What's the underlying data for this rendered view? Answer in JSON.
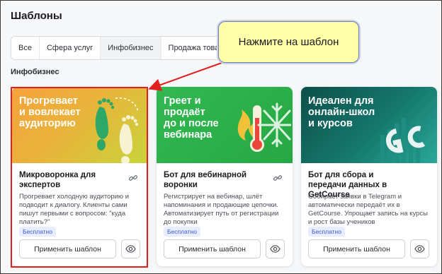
{
  "page": {
    "title": "Шаблоны"
  },
  "tabs": [
    {
      "label": "Все"
    },
    {
      "label": "Сфера услуг"
    },
    {
      "label": "Инфобизнес",
      "active": true
    },
    {
      "label": "Продажа товаров"
    }
  ],
  "section": {
    "title": "Инфобизнес"
  },
  "cards": [
    {
      "banner_text": "Прогревает\nи вовлекает\nаудиторию",
      "banner_colors": [
        "#f6a23c",
        "#c8d43a"
      ],
      "banner_icon": "footprints-icon",
      "title": "Микроворонка для экспертов",
      "description": "Прогревает холодную аудиторию и подводит к диалогу. Клиенты сами пишут первыми с вопросом: \"куда платить?\"",
      "badge": "Бесплатно",
      "button_label": "Применить шаблон"
    },
    {
      "banner_text": "Греет и\nпродаёт\nдо и после\nвебинара",
      "banner_colors": [
        "#2bb24c",
        "#26a843"
      ],
      "banner_icon": "thermometer-fire-snow-icon",
      "title": "Бот для вебинарной воронки",
      "description": "Регистрирует на вебинар, шлёт напоминания и продающие цепочки. Автоматизирует путь от регистрации до покупки",
      "badge": "Бесплатно",
      "button_label": "Применить шаблон"
    },
    {
      "banner_text": "Идеален для\nонлайн-школ\nи курсов",
      "banner_colors": [
        "#0f5e57",
        "#2aa89a"
      ],
      "banner_icon": "getcourse-logo-icon",
      "title": "Бот для сбора и передачи данных в GetCourse",
      "description": "Собирает заявки в Telegram и автоматически передаёт их в GetCourse. Упрощает запись на курсы и рост базы учеников",
      "badge": "Бесплатно",
      "button_label": "Применить шаблон"
    }
  ],
  "callout": {
    "text": "Нажмите на шаблон"
  },
  "colors": {
    "highlight": "#e0201f",
    "callout_bg": "#ffffa8",
    "badge_text": "#3a55d8"
  }
}
